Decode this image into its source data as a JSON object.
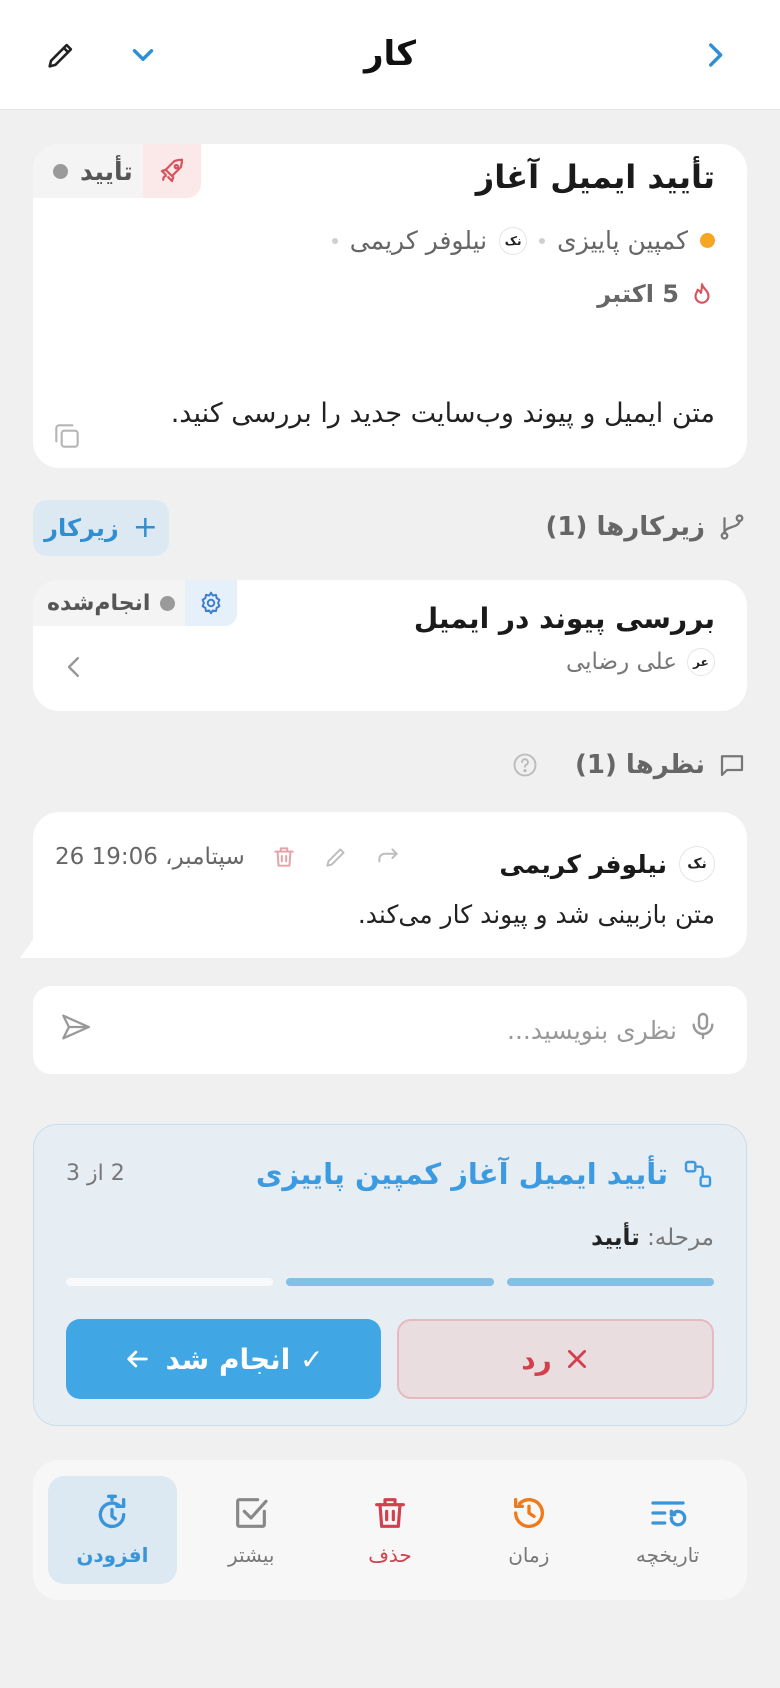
{
  "header": {
    "title": "کار"
  },
  "task": {
    "title": "تأیید ایمیل آغاز",
    "status": "تأیید",
    "status_color": "#9a9a9a",
    "campaign": "کمپین پاییزی",
    "campaign_color": "#f5a623",
    "assignee_initials": "نک",
    "assignee": "نیلوفر کریمی",
    "due": "5 اکتبر",
    "description": "متن ایمیل و پیوند وب‌سایت جدید را بررسی کنید."
  },
  "subtasks": {
    "header": "زیرکارها (1)",
    "add_label": "زیرکار",
    "items": [
      {
        "title": "بررسی پیوند در ایمیل",
        "status": "انجام‌شده",
        "assignee_initials": "عر",
        "assignee": "علی رضایی"
      }
    ]
  },
  "comments": {
    "header": "نظرها (1)",
    "items": [
      {
        "author_initials": "نک",
        "author": "نیلوفر کریمی",
        "time": "26 سپتامبر، 19:06",
        "text": "متن بازبینی شد و پیوند کار می‌کند."
      }
    ],
    "input_placeholder": "نظری بنویسید..."
  },
  "workflow": {
    "title": "تأیید ایمیل آغاز کمپین پاییزی",
    "step_text": "2 از 3",
    "current_step": 2,
    "total_steps": 3,
    "stage_label": "مرحله:",
    "stage_value": "تأیید",
    "done_label": "انجام شد ✓",
    "reject_label": "رد",
    "accent": "#40a6e4",
    "danger": "#d2404d"
  },
  "bottom_bar": [
    {
      "label": "افزودن",
      "icon": "timer-add-icon",
      "active": true
    },
    {
      "label": "بیشتر",
      "icon": "checkbox-icon"
    },
    {
      "label": "حذف",
      "icon": "trash-icon"
    },
    {
      "label": "زمان",
      "icon": "history-clock-icon"
    },
    {
      "label": "تاریخچه",
      "icon": "history-list-icon"
    }
  ]
}
